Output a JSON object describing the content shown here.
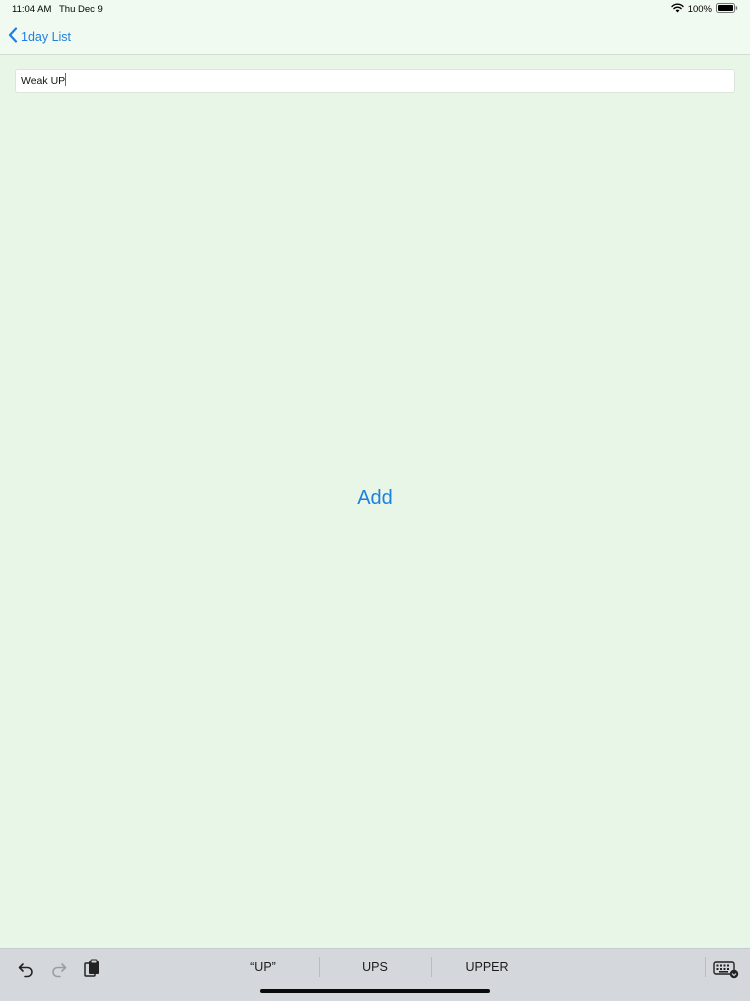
{
  "status_bar": {
    "time": "11:04 AM",
    "date": "Thu Dec 9",
    "battery": "100%",
    "wifi_icon": "wifi-icon",
    "battery_icon": "battery-icon"
  },
  "nav": {
    "back_label": "1day List",
    "back_icon": "chevron-left-icon"
  },
  "input": {
    "value": "Weak UP"
  },
  "main": {
    "add_label": "Add"
  },
  "shortcut_bar": {
    "suggestions": [
      "“UP”",
      "UPS",
      "UPPER"
    ],
    "icons": [
      "undo-icon",
      "redo-icon",
      "paste-icon",
      "keyboard-icon"
    ]
  },
  "colors": {
    "accent": "#1f7fe0",
    "background": "#e7f6e7",
    "bar": "#f1faf1",
    "keyboard_bar": "#d4d7db"
  }
}
